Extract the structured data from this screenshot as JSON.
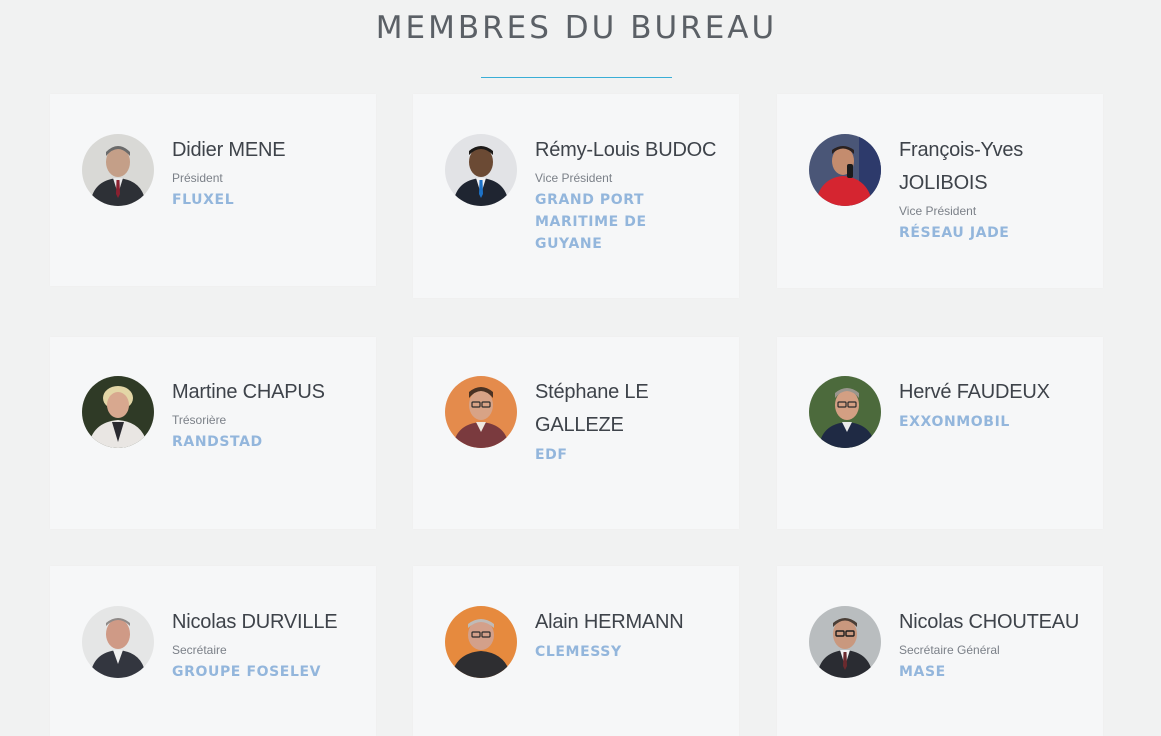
{
  "page": {
    "title": "MEMBRES DU BUREAU",
    "accent_color": "#3aaed6",
    "company_color": "#93b6dc"
  },
  "members": [
    {
      "name": "Didier MENE",
      "role": "Président",
      "company": "FLUXEL",
      "photo": "portrait-photo"
    },
    {
      "name": "Rémy-Louis BUDOC",
      "role": "Vice Président",
      "company": "GRAND PORT MARITIME DE GUYANE",
      "photo": "portrait-photo"
    },
    {
      "name": "François-Yves JOLIBOIS",
      "role": "Vice Président",
      "company": "RÉSEAU JADE",
      "photo": "portrait-photo"
    },
    {
      "name": "Martine CHAPUS",
      "role": "Trésorière",
      "company": "RANDSTAD",
      "photo": "portrait-photo"
    },
    {
      "name": "Stéphane LE GALLEZE",
      "role": "",
      "company": "EDF",
      "photo": "portrait-photo"
    },
    {
      "name": "Hervé FAUDEUX",
      "role": "",
      "company": "EXXONMOBIL",
      "photo": "portrait-photo"
    },
    {
      "name": "Nicolas DURVILLE",
      "role": "Secrétaire",
      "company": "GROUPE FOSELEV",
      "photo": "portrait-photo"
    },
    {
      "name": "Alain HERMANN",
      "role": "",
      "company": "CLEMESSY",
      "photo": "portrait-photo"
    },
    {
      "name": "Nicolas CHOUTEAU",
      "role": "Secrétaire Général",
      "company": "MASE",
      "photo": "portrait-photo"
    }
  ]
}
